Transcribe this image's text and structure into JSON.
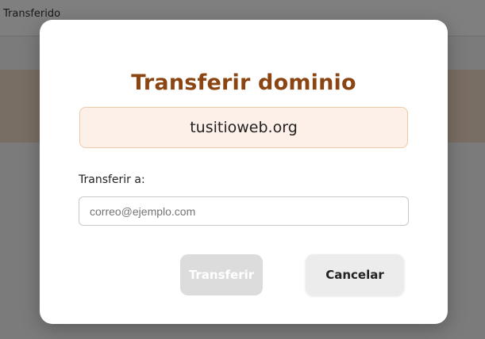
{
  "background": {
    "header_text": "Transferido"
  },
  "modal": {
    "title": "Transferir dominio",
    "domain": "tusitioweb.org",
    "field_label": "Transferir a:",
    "email_placeholder": "correo@ejemplo.com",
    "email_value": "",
    "transfer_label": "Transferir",
    "transfer_disabled": true,
    "cancel_label": "Cancelar"
  },
  "colors": {
    "title": "#8a4512",
    "domain_bg": "#fdf0e8",
    "domain_border": "#f0c9a8",
    "disabled_button": "#dcdcdc",
    "cancel_button": "#ececec"
  }
}
